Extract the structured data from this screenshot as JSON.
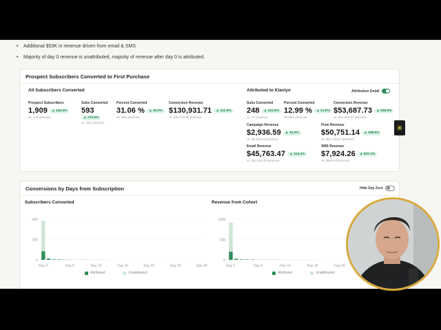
{
  "bullets": [
    "Additional $53K in revenue driven from email & SMS",
    "Majority of day 0 revenue is unattributed, majority of revenue after day 0 is attributed."
  ],
  "prospect_card": {
    "title": "Prospect Subscribers Converted to First Purchase",
    "all_title": "All Subscribers Converted",
    "attributed_title": "Attributed to Klaviyo",
    "attribution_toggle_label": "Attribution Detail",
    "all_metrics": [
      {
        "label": "Prospect Subscribers",
        "value": "1,909",
        "badge": "164.4%",
        "prev": "vs. 722 previous"
      },
      {
        "label": "Subs Converted",
        "value": "593",
        "badge": "270.6%",
        "prev": "vs. 160 previous"
      },
      {
        "label": "Percent Converted",
        "value": "31.06 %",
        "badge": "40.2%",
        "prev": "22.16% previous"
      },
      {
        "label": "Conversion Revenue",
        "value": "$130,931.71",
        "badge": "312.5%",
        "prev": "vs. $31,740.65 previous"
      }
    ],
    "attr_metrics": [
      {
        "label": "Subs Converted",
        "value": "248",
        "badge": "222.5%",
        "prev": "vs. 77 previous"
      },
      {
        "label": "Percent Converted",
        "value": "12.99 %",
        "badge": "21.8%",
        "prev": "10.66% previous"
      },
      {
        "label": "Conversion Revenue",
        "value": "$53,687.73",
        "badge": "258.9%",
        "prev": "vs. $14,960.51 previous"
      },
      {
        "label": "Campaign Revenue",
        "value": "$2,936.59",
        "badge": "32.0%",
        "prev": "vs. $2,225.24 previous"
      },
      {
        "label": "Flow Revenue",
        "value": "$50,751.14",
        "badge": "298.5%",
        "prev": "vs. $12,735.67 previous"
      },
      {
        "label": "Email Revenue",
        "value": "$45,763.47",
        "badge": "224.2%",
        "prev": "vs. $14,115.51 previous"
      },
      {
        "label": "SMS Revenue",
        "value": "$7,924.26",
        "badge": "837.3%",
        "prev": "vs. $845.40 previous"
      }
    ]
  },
  "conversions_card": {
    "title": "Conversions by Days from Subscription",
    "hide_day_zero_label": "Hide Day Zero"
  },
  "chart_data": [
    {
      "type": "bar",
      "title": "Subscribers Converted",
      "categories": [
        "Day 0",
        "Day 1",
        "Day 2",
        "Day 3",
        "Day 4",
        "Day 5",
        "Day 6",
        "Day 7",
        "Day 8",
        "Day 9",
        "Day 10",
        "Day 11",
        "Day 12",
        "Day 13",
        "Day 14",
        "Day 15",
        "Day 16",
        "Day 17",
        "Day 18",
        "Day 19",
        "Day 20",
        "Day 21",
        "Day 22",
        "Day 23",
        "Day 24",
        "Day 25",
        "Day 26",
        "Day 27",
        "Day 28",
        "Day 29",
        "Day 30"
      ],
      "x_tick_labels": [
        "Day 0",
        "Day 5",
        "Day 10",
        "Day 15",
        "Day 20",
        "Day 25",
        "Day 30"
      ],
      "y_ticks": [
        "0",
        "200",
        "400"
      ],
      "ylim": [
        0,
        450
      ],
      "series": [
        {
          "name": "Attributed",
          "values": [
            95,
            12,
            5,
            4,
            2,
            2,
            1,
            1,
            1,
            1,
            1,
            1,
            0,
            0,
            0,
            0,
            0,
            0,
            0,
            0,
            0,
            0,
            0,
            0,
            0,
            0,
            0,
            0,
            0,
            0,
            0
          ]
        },
        {
          "name": "Unattributed",
          "values": [
            340,
            10,
            4,
            3,
            3,
            2,
            2,
            1,
            1,
            1,
            1,
            1,
            1,
            0,
            0,
            0,
            0,
            0,
            0,
            0,
            0,
            0,
            0,
            0,
            0,
            0,
            0,
            0,
            0,
            0,
            0
          ]
        }
      ]
    },
    {
      "type": "bar",
      "title": "Revenue from Cohort",
      "categories": [
        "Day 0",
        "Day 1",
        "Day 2",
        "Day 3",
        "Day 4",
        "Day 5",
        "Day 6",
        "Day 7",
        "Day 8",
        "Day 9",
        "Day 10",
        "Day 11",
        "Day 12",
        "Day 13",
        "Day 14",
        "Day 15",
        "Day 16",
        "Day 17",
        "Day 18",
        "Day 19",
        "Day 20",
        "Day 21",
        "Day 22",
        "Day 23",
        "Day 24",
        "Day 25",
        "Day 26",
        "Day 27",
        "Day 28",
        "Day 29",
        "Day 30"
      ],
      "x_tick_labels": [
        "Day 0",
        "Day 5",
        "Day 10",
        "Day 15",
        "Day 20"
      ],
      "y_ticks": [
        "0",
        "50k",
        "100k"
      ],
      "ylim": [
        0,
        110000
      ],
      "series": [
        {
          "name": "Attributed",
          "values": [
            22000,
            2500,
            1200,
            900,
            700,
            500,
            400,
            300,
            300,
            200,
            200,
            200,
            100,
            100,
            100,
            100,
            0,
            0,
            0,
            0,
            0,
            0,
            0,
            0,
            0,
            0,
            0,
            0,
            0,
            0,
            0
          ]
        },
        {
          "name": "Unattributed",
          "values": [
            80000,
            2200,
            1000,
            800,
            600,
            500,
            400,
            300,
            200,
            200,
            200,
            100,
            100,
            100,
            0,
            0,
            0,
            0,
            0,
            0,
            0,
            0,
            0,
            0,
            0,
            0,
            0,
            0,
            0,
            0,
            0
          ]
        }
      ]
    }
  ],
  "legend": {
    "attributed": "Attributed",
    "unattributed": "Unattributed"
  },
  "colors": {
    "attributed": "#2f8f5b",
    "unattributed": "#cfe6d7",
    "accent": "#2f8f5b",
    "badge_bg": "#dcf3e6"
  }
}
